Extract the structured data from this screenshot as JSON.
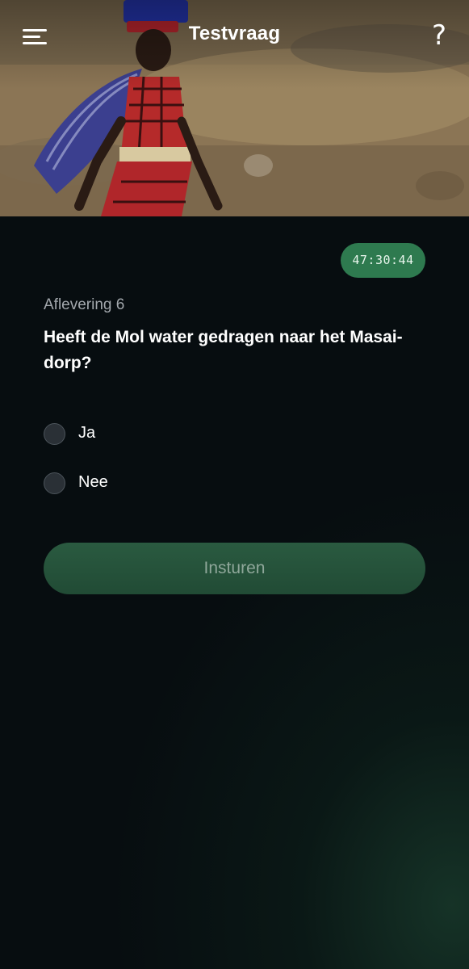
{
  "header": {
    "title": "Testvraag",
    "menu_icon": "hamburger-menu-icon",
    "help_label": "?"
  },
  "hero": {
    "image": "photo-woman-carrying-water"
  },
  "timer": {
    "value": "47:30:44"
  },
  "quiz": {
    "episode": "Aflevering 6",
    "question": "Heeft de Mol water gedragen naar het Masai-dorp?",
    "options": [
      {
        "label": "Ja",
        "selected": false
      },
      {
        "label": "Nee",
        "selected": false
      }
    ],
    "submit_label": "Insturen"
  },
  "colors": {
    "accent": "#2e7a4f",
    "background": "#070d10",
    "submit_bg": "#234e37"
  }
}
